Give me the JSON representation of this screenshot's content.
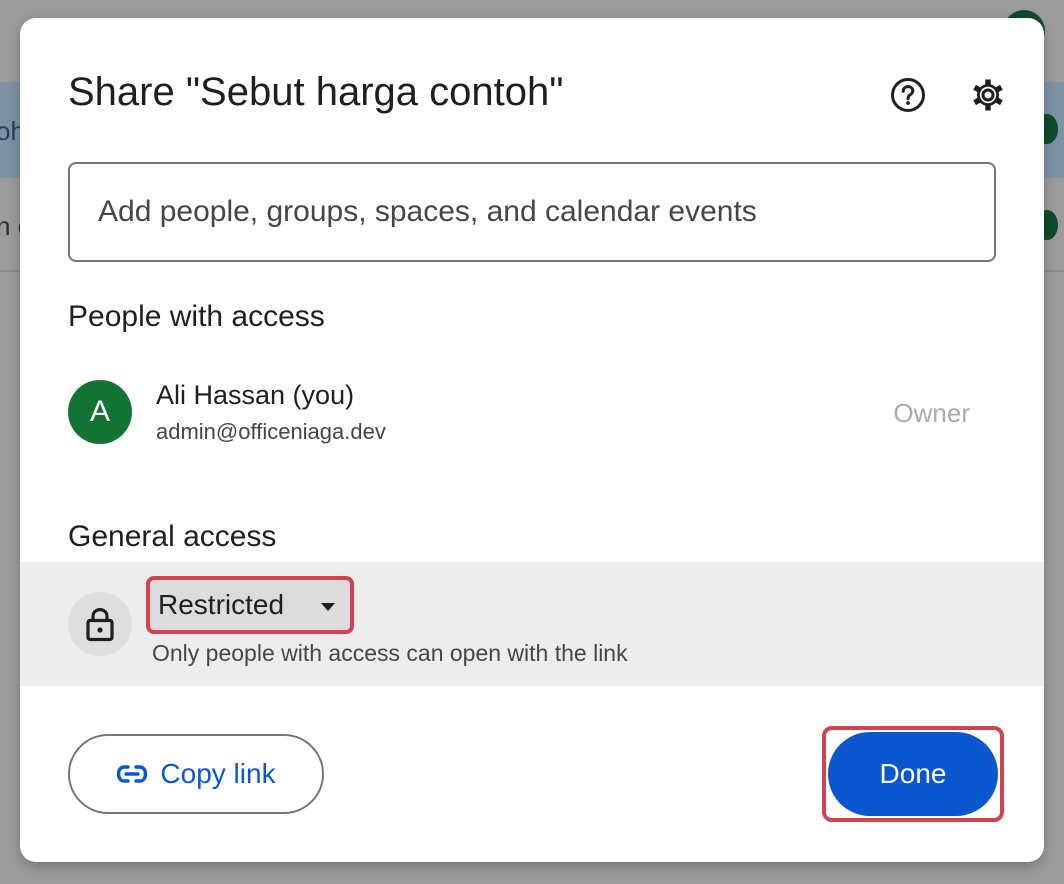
{
  "background": {
    "text_top": "oh",
    "text_bottom": "n c"
  },
  "dialog": {
    "title": "Share \"Sebut harga contoh\"",
    "help_icon": "help-circle-icon",
    "settings_icon": "gear-icon",
    "add_people_placeholder": "Add people, groups, spaces, and calendar events",
    "people_section_title": "People with access",
    "people": [
      {
        "avatar_initial": "A",
        "avatar_color": "#137333",
        "name": "Ali Hassan (you)",
        "email": "admin@officeniaga.dev",
        "role": "Owner"
      }
    ],
    "general_access_title": "General access",
    "general_access": {
      "icon": "lock-icon",
      "selected_option": "Restricted",
      "description": "Only people with access can open with the link"
    },
    "copy_link_label": "Copy link",
    "copy_link_icon": "link-icon",
    "done_label": "Done",
    "accent_color": "#0b57d0",
    "highlight_color": "#d6414f"
  }
}
